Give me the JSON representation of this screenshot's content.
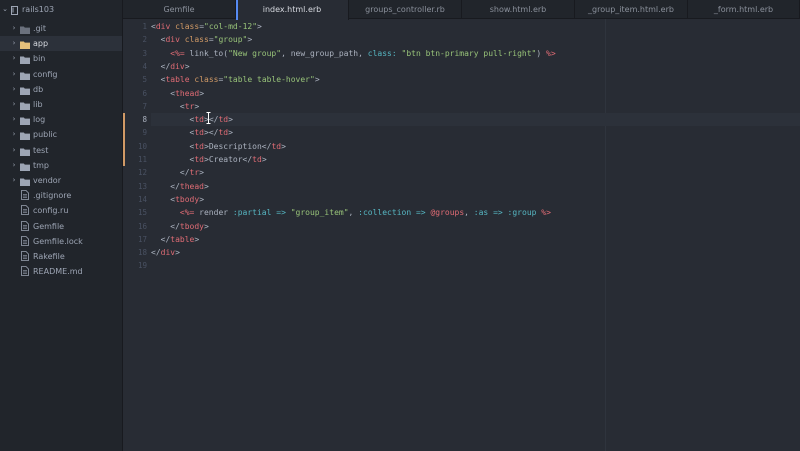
{
  "sidebar": {
    "project": "rails103",
    "items": [
      {
        "label": ".git",
        "kind": "folder",
        "color": "#9da5b4",
        "dim": true
      },
      {
        "label": "app",
        "kind": "folder",
        "color": "#e5c07b",
        "selected": true
      },
      {
        "label": "bin",
        "kind": "folder",
        "color": "#9da5b4"
      },
      {
        "label": "config",
        "kind": "folder",
        "color": "#9da5b4"
      },
      {
        "label": "db",
        "kind": "folder",
        "color": "#9da5b4"
      },
      {
        "label": "lib",
        "kind": "folder",
        "color": "#9da5b4"
      },
      {
        "label": "log",
        "kind": "folder",
        "color": "#9da5b4"
      },
      {
        "label": "public",
        "kind": "folder",
        "color": "#9da5b4"
      },
      {
        "label": "test",
        "kind": "folder",
        "color": "#9da5b4"
      },
      {
        "label": "tmp",
        "kind": "folder",
        "color": "#9da5b4"
      },
      {
        "label": "vendor",
        "kind": "folder",
        "color": "#9da5b4"
      },
      {
        "label": ".gitignore",
        "kind": "file"
      },
      {
        "label": "config.ru",
        "kind": "file"
      },
      {
        "label": "Gemfile",
        "kind": "file"
      },
      {
        "label": "Gemfile.lock",
        "kind": "file"
      },
      {
        "label": "Rakefile",
        "kind": "file"
      },
      {
        "label": "README.md",
        "kind": "file-md"
      }
    ]
  },
  "tabs": [
    {
      "label": "Gemfile",
      "active": false
    },
    {
      "label": "index.html.erb",
      "active": true
    },
    {
      "label": "groups_controller.rb",
      "active": false
    },
    {
      "label": "show.html.erb",
      "active": false
    },
    {
      "label": "_group_item.html.erb",
      "active": false
    },
    {
      "label": "_form.html.erb",
      "active": false
    }
  ],
  "editor": {
    "current_line": 8,
    "modified_lines": [
      8,
      9,
      10,
      11
    ],
    "lines": [
      [
        [
          "punct",
          "<"
        ],
        [
          "tag",
          "div"
        ],
        [
          "punct",
          " "
        ],
        [
          "attr",
          "class"
        ],
        [
          "punct",
          "="
        ],
        [
          "string",
          "\"col-md-12\""
        ],
        [
          "punct",
          ">"
        ]
      ],
      [
        [
          "punct",
          "  <"
        ],
        [
          "tag",
          "div"
        ],
        [
          "punct",
          " "
        ],
        [
          "attr",
          "class"
        ],
        [
          "punct",
          "="
        ],
        [
          "string",
          "\"group\""
        ],
        [
          "punct",
          ">"
        ]
      ],
      [
        [
          "punct",
          "    "
        ],
        [
          "embed",
          "<%="
        ],
        [
          "ruby",
          " link_to("
        ],
        [
          "string",
          "\"New group\""
        ],
        [
          "ruby",
          ", new_group_path, "
        ],
        [
          "symbol",
          "class:"
        ],
        [
          "ruby",
          " "
        ],
        [
          "string",
          "\"btn btn-primary pull-right\""
        ],
        [
          "ruby",
          ") "
        ],
        [
          "embed",
          "%>"
        ]
      ],
      [
        [
          "punct",
          "  </"
        ],
        [
          "tag",
          "div"
        ],
        [
          "punct",
          ">"
        ]
      ],
      [
        [
          "punct",
          "  <"
        ],
        [
          "tag",
          "table"
        ],
        [
          "punct",
          " "
        ],
        [
          "attr",
          "class"
        ],
        [
          "punct",
          "="
        ],
        [
          "string",
          "\"table table-hover\""
        ],
        [
          "punct",
          ">"
        ]
      ],
      [
        [
          "punct",
          "    <"
        ],
        [
          "tag",
          "thead"
        ],
        [
          "punct",
          ">"
        ]
      ],
      [
        [
          "punct",
          "      <"
        ],
        [
          "tag",
          "tr"
        ],
        [
          "punct",
          ">"
        ]
      ],
      [
        [
          "punct",
          "        <"
        ],
        [
          "tag",
          "td"
        ],
        [
          "punct",
          "></"
        ],
        [
          "tag",
          "td"
        ],
        [
          "punct",
          ">"
        ]
      ],
      [
        [
          "punct",
          "        <"
        ],
        [
          "tag",
          "td"
        ],
        [
          "punct",
          "></"
        ],
        [
          "tag",
          "td"
        ],
        [
          "punct",
          ">"
        ]
      ],
      [
        [
          "punct",
          "        <"
        ],
        [
          "tag",
          "td"
        ],
        [
          "punct",
          ">Description</"
        ],
        [
          "tag",
          "td"
        ],
        [
          "punct",
          ">"
        ]
      ],
      [
        [
          "punct",
          "        <"
        ],
        [
          "tag",
          "td"
        ],
        [
          "punct",
          ">Creator</"
        ],
        [
          "tag",
          "td"
        ],
        [
          "punct",
          ">"
        ]
      ],
      [
        [
          "punct",
          "      </"
        ],
        [
          "tag",
          "tr"
        ],
        [
          "punct",
          ">"
        ]
      ],
      [
        [
          "punct",
          "    </"
        ],
        [
          "tag",
          "thead"
        ],
        [
          "punct",
          ">"
        ]
      ],
      [
        [
          "punct",
          "    <"
        ],
        [
          "tag",
          "tbody"
        ],
        [
          "punct",
          ">"
        ]
      ],
      [
        [
          "punct",
          "      "
        ],
        [
          "embed",
          "<%="
        ],
        [
          "ruby",
          " render "
        ],
        [
          "symbol",
          ":partial"
        ],
        [
          "ruby",
          " "
        ],
        [
          "op",
          "=>"
        ],
        [
          "ruby",
          " "
        ],
        [
          "string",
          "\"group_item\""
        ],
        [
          "ruby",
          ", "
        ],
        [
          "symbol",
          ":collection"
        ],
        [
          "ruby",
          " "
        ],
        [
          "op",
          "=>"
        ],
        [
          "ruby",
          " "
        ],
        [
          "ivar",
          "@groups"
        ],
        [
          "ruby",
          ", "
        ],
        [
          "symbol",
          ":as"
        ],
        [
          "ruby",
          " "
        ],
        [
          "op",
          "=>"
        ],
        [
          "ruby",
          " "
        ],
        [
          "symbol",
          ":group"
        ],
        [
          "ruby",
          " "
        ],
        [
          "embed",
          "%>"
        ]
      ],
      [
        [
          "punct",
          "    </"
        ],
        [
          "tag",
          "tbody"
        ],
        [
          "punct",
          ">"
        ]
      ],
      [
        [
          "punct",
          "  </"
        ],
        [
          "tag",
          "table"
        ],
        [
          "punct",
          ">"
        ]
      ],
      [
        [
          "punct",
          "</"
        ],
        [
          "tag",
          "div"
        ],
        [
          "punct",
          ">"
        ]
      ],
      []
    ]
  }
}
